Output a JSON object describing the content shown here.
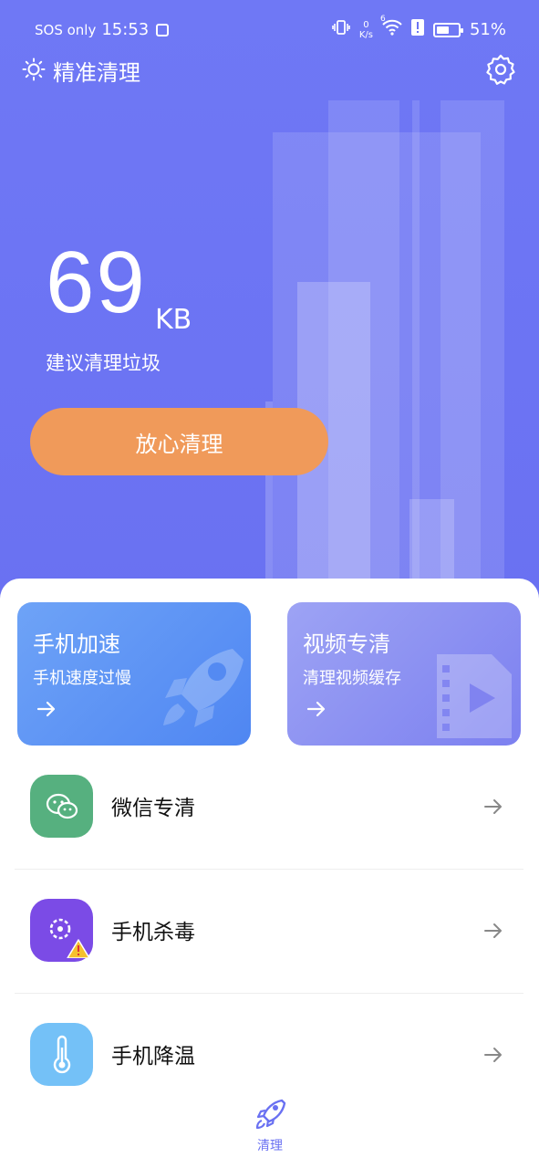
{
  "status_bar": {
    "carrier": "SOS only",
    "time": "15:53",
    "net_speed_value": "0",
    "net_speed_unit": "K/s",
    "battery": "51%",
    "wifi_label": "6"
  },
  "header": {
    "title": "精准清理",
    "sun_icon": "sun-icon",
    "settings_icon": "gear-icon"
  },
  "junk": {
    "amount": "69",
    "unit": "KB",
    "caption": "建议清理垃圾",
    "button_label": "放心清理"
  },
  "cards": [
    {
      "title": "手机加速",
      "subtitle": "手机速度过慢",
      "icon": "rocket-icon"
    },
    {
      "title": "视频专清",
      "subtitle": "清理视频缓存",
      "icon": "video-icon"
    }
  ],
  "tools": [
    {
      "label": "微信专清",
      "icon": "wechat-icon",
      "color": "#56b07f"
    },
    {
      "label": "手机杀毒",
      "icon": "virus-warning-icon",
      "color": "#7b4be6"
    },
    {
      "label": "手机降温",
      "icon": "thermometer-icon",
      "color": "#74c1f7"
    }
  ],
  "bottom_nav": {
    "label": "清理",
    "icon": "rocket-icon"
  },
  "colors": {
    "primary": "#6a71f2",
    "button": "#f09a5a",
    "speed_card": "#5b91f4",
    "video_card": "#8a8ff2"
  }
}
